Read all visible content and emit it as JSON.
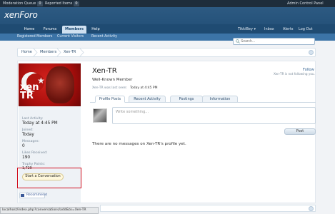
{
  "modbar": {
    "moderation_queue": "Moderation Queue",
    "moderation_count": "0",
    "reported_items": "Reported Items",
    "reported_count": "0",
    "admin_cp": "Admin Control Panel"
  },
  "logo": "xenForo",
  "nav": {
    "tabs": [
      "Home",
      "Forums",
      "Members",
      "Help"
    ],
    "selected": "Members",
    "user": "TikkiBey",
    "right": [
      "Inbox",
      "Alerts",
      "Log Out"
    ]
  },
  "subnav": [
    "Registered Members",
    "Current Visitors",
    "Recent Activity"
  ],
  "search": {
    "placeholder": "Search..."
  },
  "breadcrumb": [
    "Home",
    "Members",
    "Xen-TR"
  ],
  "sidebar": {
    "stats": [
      {
        "label": "Last Activity:",
        "value": "Today at 4:45 PM"
      },
      {
        "label": "Joined:",
        "value": "Today"
      },
      {
        "label": "Messages:",
        "value": "0"
      },
      {
        "label": "Likes Received:",
        "value": "190"
      },
      {
        "label": "Trophy Points:",
        "value": "1,729"
      }
    ],
    "start_conversation": "Start a Conversation",
    "recommend": "Recommend"
  },
  "profile": {
    "username": "Xen-TR",
    "title": "Well-Known Member",
    "last_seen_label": "Xen-TR was last seen:",
    "last_seen_value": "Today at 4:45 PM",
    "follow": "Follow",
    "not_following": "Xen-TR is not following you."
  },
  "tabs": [
    "Profile Posts",
    "Recent Activity",
    "Postings",
    "Information"
  ],
  "post": {
    "placeholder": "Write something...",
    "button": "Post",
    "empty": "There are no messages on Xen-TR's profile yet."
  },
  "status_url": "localhost/index.php?conversations/add&to=Xen-TR",
  "colors": {
    "header": "#2d5a82",
    "nav": "#1f4b72",
    "subnav": "#3c74a7",
    "highlight": "#d10f1f"
  }
}
